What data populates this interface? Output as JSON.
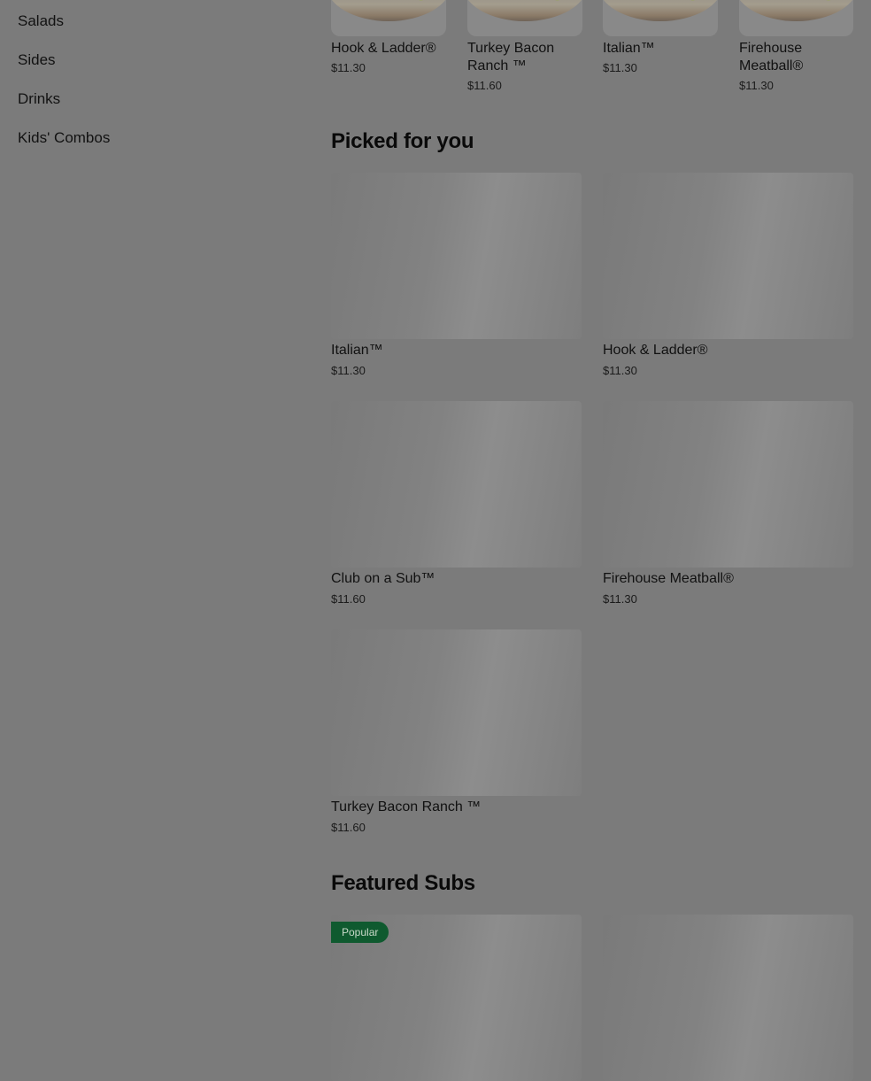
{
  "sidebar": {
    "items": [
      {
        "label": "Salads"
      },
      {
        "label": "Sides"
      },
      {
        "label": "Drinks"
      },
      {
        "label": "Kids' Combos"
      }
    ]
  },
  "top_row": [
    {
      "name": "Hook & Ladder®",
      "price": "$11.30"
    },
    {
      "name": "Turkey Bacon Ranch ™",
      "price": "$11.60"
    },
    {
      "name": "Italian™",
      "price": "$11.30"
    },
    {
      "name": "Firehouse Meatball®",
      "price": "$11.30"
    }
  ],
  "picked": {
    "title": "Picked for you",
    "items": [
      {
        "name": "Italian™",
        "price": "$11.30"
      },
      {
        "name": "Hook & Ladder®",
        "price": "$11.30"
      },
      {
        "name": "Club on a Sub™",
        "price": "$11.60"
      },
      {
        "name": "Firehouse Meatball®",
        "price": "$11.30"
      },
      {
        "name": "Turkey Bacon Ranch ™",
        "price": "$11.60"
      }
    ]
  },
  "featured": {
    "title": "Featured Subs",
    "badge": "Popular"
  }
}
